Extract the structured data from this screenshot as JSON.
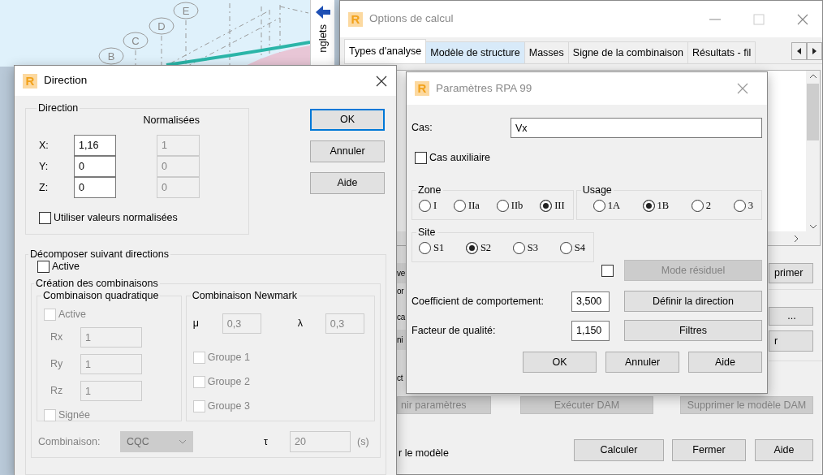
{
  "cad_view": {
    "axis_markers": [
      "E",
      "D",
      "C",
      "B"
    ]
  },
  "side_tab": {
    "label": "nglets"
  },
  "options_window": {
    "logo": "R",
    "title": "Options de calcul",
    "tabs": [
      {
        "label": "Types d'analyse",
        "selected": true,
        "hovered": false
      },
      {
        "label": "Modèle de structure",
        "selected": false,
        "hovered": true
      },
      {
        "label": "Masses",
        "selected": false,
        "hovered": false
      },
      {
        "label": "Signe de la combinaison",
        "selected": false,
        "hovered": false
      },
      {
        "label": "Résultats - fil",
        "selected": false,
        "hovered": false
      }
    ],
    "left_fragments": [
      {
        "kind": "button",
        "text": "ve"
      },
      {
        "kind": "text",
        "text": "or"
      },
      {
        "kind": "text",
        "text": "ca"
      },
      {
        "kind": "button",
        "text": "ni"
      },
      {
        "kind": "text",
        "text": "ct"
      }
    ],
    "right_buttons": [
      "primer",
      "...",
      "r"
    ],
    "dam_buttons": [
      {
        "label": "nir paramètres",
        "disabled": true
      },
      {
        "label": "Exécuter DAM",
        "disabled": true
      },
      {
        "label": "Supprimer le modèle DAM",
        "disabled": true
      }
    ],
    "footer_text": "r le modèle",
    "footer_buttons": [
      "Calculer",
      "Fermer",
      "Aide"
    ]
  },
  "direction_dialog": {
    "logo": "R",
    "title": "Direction",
    "direction_group": {
      "legend": "Direction",
      "normalized_heading": "Normalisées",
      "rows": [
        {
          "axis": "X:",
          "value": "1,16",
          "normalized": "1"
        },
        {
          "axis": "Y:",
          "value": "0",
          "normalized": "0"
        },
        {
          "axis": "Z:",
          "value": "0",
          "normalized": "0"
        }
      ],
      "use_normalized": {
        "label": "Utiliser valeurs normalisées",
        "checked": false,
        "disabled": false
      }
    },
    "buttons": [
      {
        "label": "OK",
        "focused": true
      },
      {
        "label": "Annuler",
        "focused": false
      },
      {
        "label": "Aide",
        "focused": false
      }
    ],
    "decompose": {
      "legend": "Décomposer suivant directions",
      "active": {
        "label": "Active",
        "checked": false,
        "disabled": false
      },
      "creation": {
        "legend": "Création des combinaisons",
        "quadratic": {
          "legend": "Combinaison quadratique",
          "active": {
            "label": "Active",
            "checked": false,
            "disabled": true
          },
          "rows": [
            {
              "label": "Rx",
              "value": "1"
            },
            {
              "label": "Ry",
              "value": "1"
            },
            {
              "label": "Rz",
              "value": "1"
            }
          ],
          "signed": {
            "label": "Signée",
            "checked": false,
            "disabled": true
          }
        },
        "newmark": {
          "legend": "Combinaison Newmark",
          "mu": {
            "symbol": "μ",
            "value": "0,3"
          },
          "lambda": {
            "symbol": "λ",
            "value": "0,3"
          },
          "groups": [
            {
              "label": "Groupe 1",
              "checked": false,
              "disabled": true
            },
            {
              "label": "Groupe 2",
              "checked": false,
              "disabled": true
            },
            {
              "label": "Groupe 3",
              "checked": false,
              "disabled": true
            }
          ]
        },
        "combination": {
          "label": "Combinaison:",
          "value": "CQC"
        },
        "tau": {
          "symbol": "τ",
          "value": "20",
          "unit": "(s)"
        }
      }
    }
  },
  "rpa_dialog": {
    "logo": "R",
    "title": "Paramètres RPA 99",
    "case": {
      "label": "Cas:",
      "value": "Vx"
    },
    "auxiliary": {
      "label": "Cas auxiliaire",
      "checked": false,
      "disabled": false
    },
    "groups": [
      {
        "legend": "Zone",
        "options": [
          {
            "label": "I",
            "selected": false
          },
          {
            "label": "IIa",
            "selected": false
          },
          {
            "label": "IIb",
            "selected": false
          },
          {
            "label": "III",
            "selected": true
          }
        ]
      },
      {
        "legend": "Usage",
        "options": [
          {
            "label": "1A",
            "selected": false
          },
          {
            "label": "1B",
            "selected": true
          },
          {
            "label": "2",
            "selected": false
          },
          {
            "label": "3",
            "selected": false
          }
        ]
      },
      {
        "legend": "Site",
        "options": [
          {
            "label": "S1",
            "selected": false
          },
          {
            "label": "S2",
            "selected": true
          },
          {
            "label": "S3",
            "selected": false
          },
          {
            "label": "S4",
            "selected": false
          }
        ]
      }
    ],
    "residual": {
      "checked": false,
      "button": "Mode résiduel",
      "disabled": true
    },
    "fields": [
      {
        "label": "Coefficient de comportement:",
        "value": "3,500",
        "button": "Définir la direction"
      },
      {
        "label": "Facteur de qualité:",
        "value": "1,150",
        "button": "Filtres"
      }
    ],
    "buttons": [
      "OK",
      "Annuler",
      "Aide"
    ]
  }
}
